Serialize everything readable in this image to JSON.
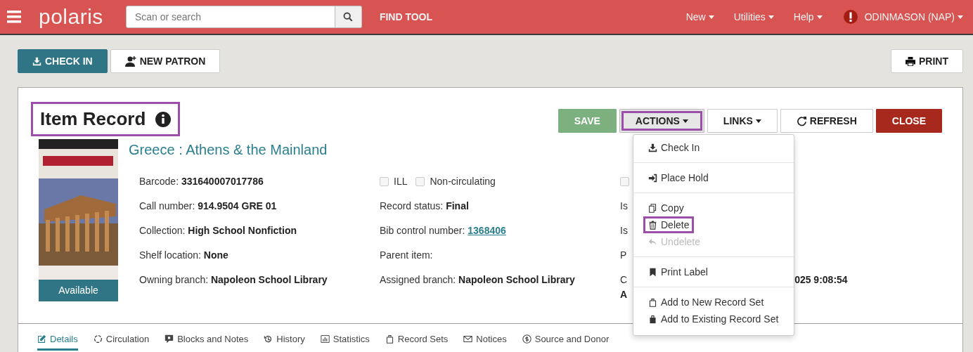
{
  "topbar": {
    "brand": "polaris",
    "search": {
      "placeholder": "Scan or search"
    },
    "find_tool": "FIND TOOL",
    "menus": [
      {
        "label": "New"
      },
      {
        "label": "Utilities"
      },
      {
        "label": "Help"
      }
    ],
    "user": "ODINMASON (NAP)"
  },
  "toolbar": {
    "buttons": [
      {
        "label": "CHECK IN",
        "kind": "primary"
      },
      {
        "label": "NEW PATRON",
        "kind": "plain"
      }
    ],
    "print": "PRINT"
  },
  "record": {
    "title": "Item Record",
    "title_highlighted": true,
    "buttons": [
      {
        "label": "SAVE",
        "kind": "save",
        "caret": false,
        "highlighted": false,
        "expanded": false
      },
      {
        "label": "ACTIONS",
        "kind": "menu",
        "caret": true,
        "highlighted": true,
        "expanded": true
      },
      {
        "label": "LINKS",
        "kind": "plain",
        "caret": true,
        "highlighted": false,
        "expanded": false
      },
      {
        "label": "REFRESH",
        "kind": "refresh",
        "caret": false,
        "highlighted": false,
        "expanded": false
      },
      {
        "label": "CLOSE",
        "kind": "close",
        "caret": false,
        "highlighted": false,
        "expanded": false
      }
    ],
    "cover": {
      "status": "Available"
    },
    "book_title": "Greece : Athens & the Mainland",
    "columns": [
      [
        {
          "kind": "text",
          "label": "Barcode:",
          "value": "331640007017786"
        },
        {
          "kind": "text",
          "label": "Call number:",
          "value": "914.9504 GRE 01"
        },
        {
          "kind": "text",
          "label": "Collection:",
          "value": "High School Nonfiction"
        },
        {
          "kind": "text",
          "label": "Shelf location:",
          "value": "None"
        },
        {
          "kind": "text",
          "label": "Owning branch:",
          "value": "Napoleon School Library"
        }
      ],
      [
        {
          "kind": "checks",
          "checks": [
            {
              "label": "ILL",
              "checked": false
            },
            {
              "label": "Non-circulating",
              "checked": false
            }
          ]
        },
        {
          "kind": "text",
          "label": "Record status:",
          "value": "Final"
        },
        {
          "kind": "link",
          "label": "Bib control number:",
          "value": "1368406"
        },
        {
          "kind": "text",
          "label": "Parent item:"
        },
        {
          "kind": "text",
          "label": "Assigned branch:",
          "value": "Napoleon School Library"
        }
      ],
      [
        {
          "kind": "checks",
          "checks": [
            {
              "checked": false
            }
          ]
        },
        {
          "kind": "text",
          "label": "Is"
        },
        {
          "kind": "text",
          "label": "Is"
        },
        {
          "kind": "text",
          "label": "P"
        },
        {
          "kind": "split",
          "label": "C",
          "value": "025 9:08:54",
          "value2": "A"
        }
      ]
    ]
  },
  "menu": {
    "groups": [
      [
        {
          "label": "Check In",
          "disabled": false,
          "highlighted": false
        }
      ],
      [
        {
          "label": "Place Hold",
          "disabled": false,
          "highlighted": false
        }
      ],
      [
        {
          "label": "Copy",
          "disabled": false,
          "highlighted": false
        },
        {
          "label": "Delete",
          "disabled": false,
          "highlighted": true
        },
        {
          "label": "Undelete",
          "disabled": true,
          "highlighted": false
        }
      ],
      [
        {
          "label": "Print Label",
          "disabled": false,
          "highlighted": false
        }
      ],
      [
        {
          "label": "Add to New Record Set",
          "disabled": false,
          "highlighted": false
        },
        {
          "label": "Add to Existing Record Set",
          "disabled": false,
          "highlighted": false
        }
      ]
    ]
  },
  "tabs": [
    {
      "label": "Details",
      "selected": true
    },
    {
      "label": "Circulation",
      "selected": false
    },
    {
      "label": "Blocks and Notes",
      "selected": false
    },
    {
      "label": "History",
      "selected": false
    },
    {
      "label": "Statistics",
      "selected": false
    },
    {
      "label": "Record Sets",
      "selected": false
    },
    {
      "label": "Notices",
      "selected": false
    },
    {
      "label": "Source and Donor",
      "selected": false
    }
  ]
}
